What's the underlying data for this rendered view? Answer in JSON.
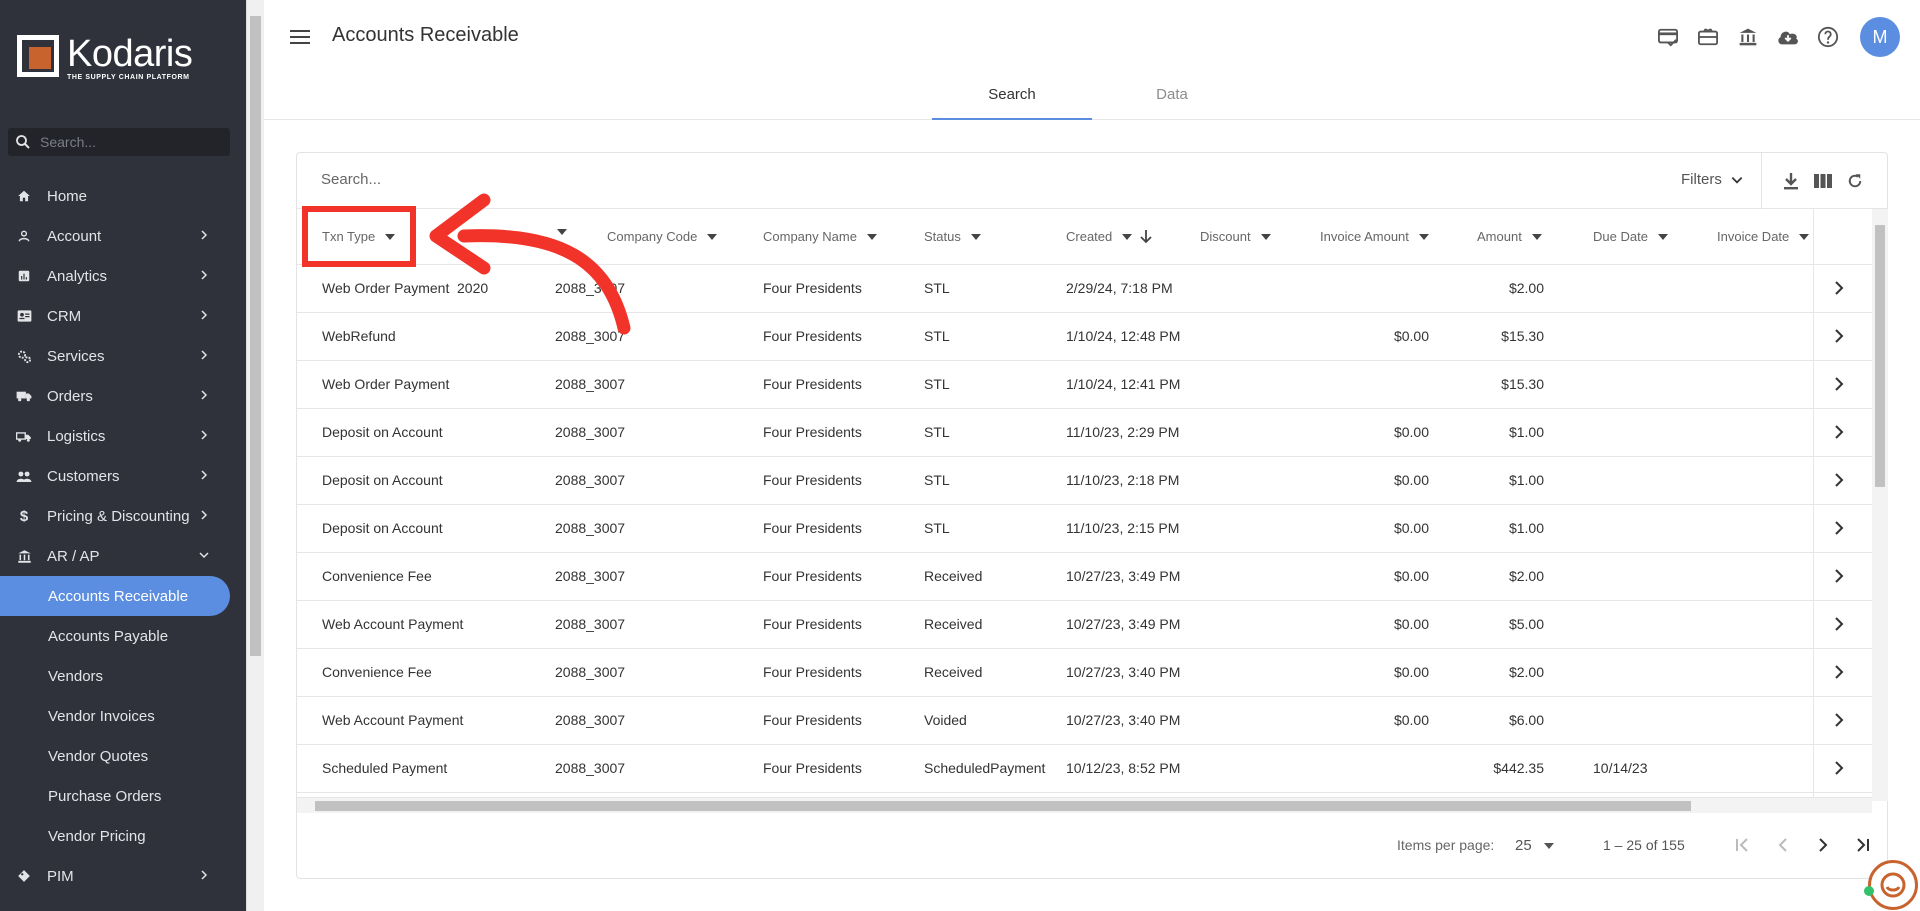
{
  "brand": {
    "name": "Kodaris",
    "tagline": "THE SUPPLY CHAIN PLATFORM",
    "accent": "#5b8ee0",
    "logo_orange": "#c8632d"
  },
  "sidebar": {
    "search_placeholder": "Search...",
    "items": [
      {
        "label": "Home",
        "icon": "home-icon",
        "chevron": false
      },
      {
        "label": "Account",
        "icon": "person-icon",
        "chevron": true
      },
      {
        "label": "Analytics",
        "icon": "analytics-icon",
        "chevron": true
      },
      {
        "label": "CRM",
        "icon": "contact-card-icon",
        "chevron": true
      },
      {
        "label": "Services",
        "icon": "gears-icon",
        "chevron": true
      },
      {
        "label": "Orders",
        "icon": "truck-icon",
        "chevron": true
      },
      {
        "label": "Logistics",
        "icon": "shipping-icon",
        "chevron": true
      },
      {
        "label": "Customers",
        "icon": "people-icon",
        "chevron": true
      },
      {
        "label": "Pricing & Discounting",
        "icon": "dollar-icon",
        "chevron": true
      },
      {
        "label": "AR / AP",
        "icon": "bank-icon",
        "chevron": "down"
      }
    ],
    "sub_items": [
      {
        "label": "Accounts Receivable",
        "active": true
      },
      {
        "label": "Accounts Payable",
        "active": false
      },
      {
        "label": "Vendors",
        "active": false
      },
      {
        "label": "Vendor Invoices",
        "active": false
      },
      {
        "label": "Vendor Quotes",
        "active": false
      },
      {
        "label": "Purchase Orders",
        "active": false
      },
      {
        "label": "Vendor Pricing",
        "active": false
      }
    ],
    "after_items": [
      {
        "label": "PIM",
        "icon": "tag-icon",
        "chevron": true
      }
    ]
  },
  "header": {
    "title": "Accounts Receivable",
    "avatar_initial": "M",
    "icons": [
      "card-check-icon",
      "gift-card-icon",
      "bank-icon",
      "cloud-download-icon",
      "help-icon"
    ]
  },
  "tabs": [
    {
      "label": "Search",
      "active": true
    },
    {
      "label": "Data",
      "active": false
    }
  ],
  "toolbar": {
    "search_placeholder": "Search...",
    "filters_label": "Filters"
  },
  "table": {
    "columns": [
      "Txn Type",
      "",
      "Company Code",
      "Company Name",
      "Status",
      "Created",
      "Discount",
      "Invoice Amount",
      "Amount",
      "Due Date",
      "Invoice Date"
    ],
    "rows": [
      {
        "txn_type": "Web Order Payment",
        "col2": "2020",
        "company_code": "2088_3007",
        "company_name": "Four Presidents",
        "status": "STL",
        "created": "2/29/24, 7:18 PM",
        "discount": "",
        "invoice_amount": "",
        "amount": "$2.00",
        "due_date": "",
        "invoice_date": ""
      },
      {
        "txn_type": "WebRefund",
        "col2": "",
        "company_code": "2088_3007",
        "company_name": "Four Presidents",
        "status": "STL",
        "created": "1/10/24, 12:48 PM",
        "discount": "",
        "invoice_amount": "$0.00",
        "amount": "$15.30",
        "due_date": "",
        "invoice_date": ""
      },
      {
        "txn_type": "Web Order Payment",
        "col2": "",
        "company_code": "2088_3007",
        "company_name": "Four Presidents",
        "status": "STL",
        "created": "1/10/24, 12:41 PM",
        "discount": "",
        "invoice_amount": "",
        "amount": "$15.30",
        "due_date": "",
        "invoice_date": ""
      },
      {
        "txn_type": "Deposit on Account",
        "col2": "",
        "company_code": "2088_3007",
        "company_name": "Four Presidents",
        "status": "STL",
        "created": "11/10/23, 2:29 PM",
        "discount": "",
        "invoice_amount": "$0.00",
        "amount": "$1.00",
        "due_date": "",
        "invoice_date": ""
      },
      {
        "txn_type": "Deposit on Account",
        "col2": "",
        "company_code": "2088_3007",
        "company_name": "Four Presidents",
        "status": "STL",
        "created": "11/10/23, 2:18 PM",
        "discount": "",
        "invoice_amount": "$0.00",
        "amount": "$1.00",
        "due_date": "",
        "invoice_date": ""
      },
      {
        "txn_type": "Deposit on Account",
        "col2": "",
        "company_code": "2088_3007",
        "company_name": "Four Presidents",
        "status": "STL",
        "created": "11/10/23, 2:15 PM",
        "discount": "",
        "invoice_amount": "$0.00",
        "amount": "$1.00",
        "due_date": "",
        "invoice_date": ""
      },
      {
        "txn_type": "Convenience Fee",
        "col2": "",
        "company_code": "2088_3007",
        "company_name": "Four Presidents",
        "status": "Received",
        "created": "10/27/23, 3:49 PM",
        "discount": "",
        "invoice_amount": "$0.00",
        "amount": "$2.00",
        "due_date": "",
        "invoice_date": ""
      },
      {
        "txn_type": "Web Account Payment",
        "col2": "",
        "company_code": "2088_3007",
        "company_name": "Four Presidents",
        "status": "Received",
        "created": "10/27/23, 3:49 PM",
        "discount": "",
        "invoice_amount": "$0.00",
        "amount": "$5.00",
        "due_date": "",
        "invoice_date": ""
      },
      {
        "txn_type": "Convenience Fee",
        "col2": "",
        "company_code": "2088_3007",
        "company_name": "Four Presidents",
        "status": "Received",
        "created": "10/27/23, 3:40 PM",
        "discount": "",
        "invoice_amount": "$0.00",
        "amount": "$2.00",
        "due_date": "",
        "invoice_date": ""
      },
      {
        "txn_type": "Web Account Payment",
        "col2": "",
        "company_code": "2088_3007",
        "company_name": "Four Presidents",
        "status": "Voided",
        "created": "10/27/23, 3:40 PM",
        "discount": "",
        "invoice_amount": "$0.00",
        "amount": "$6.00",
        "due_date": "",
        "invoice_date": ""
      },
      {
        "txn_type": "Scheduled Payment",
        "col2": "",
        "company_code": "2088_3007",
        "company_name": "Four Presidents",
        "status": "ScheduledPayment",
        "created": "10/12/23, 8:52 PM",
        "discount": "",
        "invoice_amount": "",
        "amount": "$442.35",
        "due_date": "10/14/23",
        "invoice_date": ""
      }
    ]
  },
  "paginator": {
    "items_per_page_label": "Items per page:",
    "page_size": "25",
    "range": "1 – 25 of 155"
  },
  "annotation": {
    "color": "#f2332a"
  }
}
